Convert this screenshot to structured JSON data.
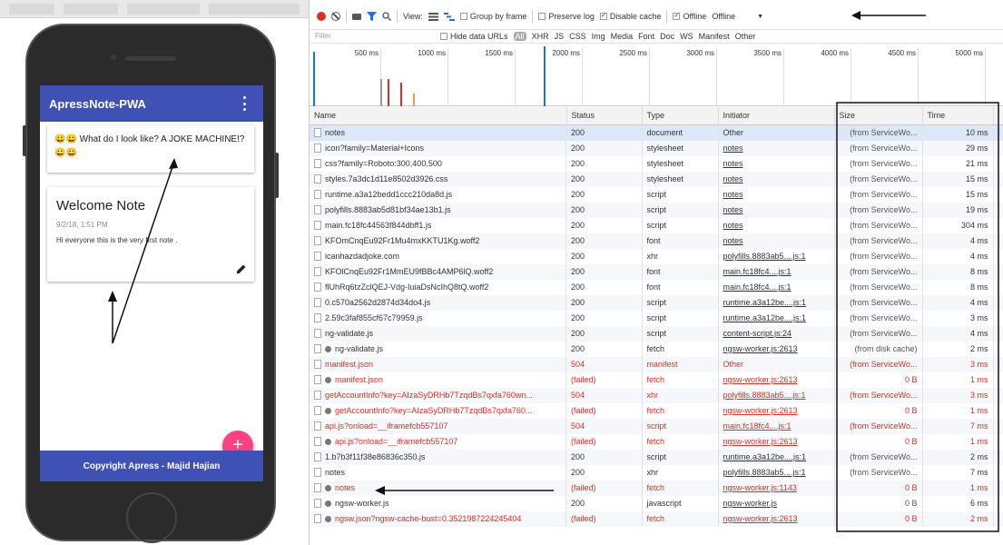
{
  "phone": {
    "app_title": "ApressNote-PWA",
    "joke_text": "😀😀 What do I look like? A JOKE MACHINE!? 😀😀",
    "note_title": "Welcome Note",
    "note_date": "9/2/18, 1:51 PM",
    "note_body": "Hi everyone this is the very first note .",
    "fab_label": "+",
    "footer_text": "Copyright Apress - Majid Hajian"
  },
  "toolbar": {
    "view_label": "View:",
    "group_by_frame": "Group by frame",
    "preserve_log": "Preserve log",
    "disable_cache": "Disable cache",
    "offline_check": "Offline",
    "throttle_select": "Offline",
    "disable_cache_checked": true,
    "offline_checked": true
  },
  "filterbar": {
    "filter_placeholder": "Filter",
    "hide_data_urls": "Hide data URLs",
    "types": [
      "All",
      "XHR",
      "JS",
      "CSS",
      "Img",
      "Media",
      "Font",
      "Doc",
      "WS",
      "Manifest",
      "Other"
    ]
  },
  "timeline": {
    "ticks": [
      "500 ms",
      "1000 ms",
      "1500 ms",
      "2000 ms",
      "2500 ms",
      "3000 ms",
      "3500 ms",
      "4000 ms",
      "4500 ms",
      "5000 ms"
    ]
  },
  "table": {
    "columns": [
      "Name",
      "Status",
      "Type",
      "Initiator",
      "Size",
      "Time"
    ],
    "rows": [
      {
        "name": "notes",
        "status": "200",
        "type": "document",
        "initiator": "Other",
        "size": "(from ServiceWo...",
        "time": "10 ms",
        "gear": false,
        "error": false,
        "selected": true,
        "link": false
      },
      {
        "name": "icon?family=Material+Icons",
        "status": "200",
        "type": "stylesheet",
        "initiator": "notes",
        "size": "(from ServiceWo...",
        "time": "29 ms",
        "gear": false,
        "error": false,
        "link": true
      },
      {
        "name": "css?family=Roboto:300,400,500",
        "status": "200",
        "type": "stylesheet",
        "initiator": "notes",
        "size": "(from ServiceWo...",
        "time": "21 ms",
        "gear": false,
        "error": false,
        "link": true
      },
      {
        "name": "styles.7a3dc1d11e8502d3926.css",
        "status": "200",
        "type": "stylesheet",
        "initiator": "notes",
        "size": "(from ServiceWo...",
        "time": "15 ms",
        "gear": false,
        "error": false,
        "link": true
      },
      {
        "name": "runtime.a3a12bedd1ccc210da8d.js",
        "status": "200",
        "type": "script",
        "initiator": "notes",
        "size": "(from ServiceWo...",
        "time": "15 ms",
        "gear": false,
        "error": false,
        "link": true
      },
      {
        "name": "polyfills.8883ab5d81bf34ae13b1.js",
        "status": "200",
        "type": "script",
        "initiator": "notes",
        "size": "(from ServiceWo...",
        "time": "19 ms",
        "gear": false,
        "error": false,
        "link": true
      },
      {
        "name": "main.fc18fc44563f844dbff1.js",
        "status": "200",
        "type": "script",
        "initiator": "notes",
        "size": "(from ServiceWo...",
        "time": "304 ms",
        "gear": false,
        "error": false,
        "link": true
      },
      {
        "name": "KFOmCnqEu92Fr1Mu4mxKKTU1Kg.woff2",
        "status": "200",
        "type": "font",
        "initiator": "notes",
        "size": "(from ServiceWo...",
        "time": "4 ms",
        "gear": false,
        "error": false,
        "link": true
      },
      {
        "name": "icanhazdadjoke.com",
        "status": "200",
        "type": "xhr",
        "initiator": "polyfills.8883ab5....js:1",
        "size": "(from ServiceWo...",
        "time": "4 ms",
        "gear": false,
        "error": false,
        "link": true
      },
      {
        "name": "KFOlCnqEu92Fr1MmEU9fBBc4AMP6lQ.woff2",
        "status": "200",
        "type": "font",
        "initiator": "main.fc18fc4....js:1",
        "size": "(from ServiceWo...",
        "time": "8 ms",
        "gear": false,
        "error": false,
        "link": true
      },
      {
        "name": "flUhRq6tzZclQEJ-Vdg-IuiaDsNcIhQ8tQ.woff2",
        "status": "200",
        "type": "font",
        "initiator": "main.fc18fc4....js:1",
        "size": "(from ServiceWo...",
        "time": "8 ms",
        "gear": false,
        "error": false,
        "link": true
      },
      {
        "name": "0.c570a2562d2874d34do4.js",
        "status": "200",
        "type": "script",
        "initiator": "runtime.a3a12be....js:1",
        "size": "(from ServiceWo...",
        "time": "4 ms",
        "gear": false,
        "error": false,
        "link": true
      },
      {
        "name": "2.59c3faf855cf67c79959.js",
        "status": "200",
        "type": "script",
        "initiator": "runtime.a3a12be....js:1",
        "size": "(from ServiceWo...",
        "time": "3 ms",
        "gear": false,
        "error": false,
        "link": true
      },
      {
        "name": "ng-validate.js",
        "status": "200",
        "type": "script",
        "initiator": "content-script.js:24",
        "size": "(from ServiceWo...",
        "time": "4 ms",
        "gear": false,
        "error": false,
        "link": true
      },
      {
        "name": "ng-validate.js",
        "status": "200",
        "type": "fetch",
        "initiator": "ngsw-worker.js:2613",
        "size": "(from disk cache)",
        "time": "2 ms",
        "gear": true,
        "error": false,
        "link": true
      },
      {
        "name": "manifest.json",
        "status": "504",
        "type": "manifest",
        "initiator": "Other",
        "size": "(from ServiceWo...",
        "time": "3 ms",
        "gear": false,
        "error": true,
        "link": false
      },
      {
        "name": "manifest.json",
        "status": "(failed)",
        "type": "fetch",
        "initiator": "ngsw-worker.js:2613",
        "size": "0 B",
        "time": "1 ms",
        "gear": true,
        "error": true,
        "link": true
      },
      {
        "name": "getAccountInfo?key=AIzaSyDRHb7TzqdBs7qxfa760wn...",
        "status": "504",
        "type": "xhr",
        "initiator": "polyfills.8883ab5....js:1",
        "size": "(from ServiceWo...",
        "time": "3 ms",
        "gear": false,
        "error": true,
        "link": true
      },
      {
        "name": "getAccountInfo?key=AIzaSyDRHb7TzqdBs7qxfa760...",
        "status": "(failed)",
        "type": "fetch",
        "initiator": "ngsw-worker.js:2613",
        "size": "0 B",
        "time": "1 ms",
        "gear": true,
        "error": true,
        "link": true
      },
      {
        "name": "api.js?onload=__iframefcb557107",
        "status": "504",
        "type": "script",
        "initiator": "main.fc18fc4....js:1",
        "size": "(from ServiceWo...",
        "time": "7 ms",
        "gear": false,
        "error": true,
        "link": true
      },
      {
        "name": "api.js?onload=__iframefcb557107",
        "status": "(failed)",
        "type": "fetch",
        "initiator": "ngsw-worker.js:2613",
        "size": "0 B",
        "time": "1 ms",
        "gear": true,
        "error": true,
        "link": true
      },
      {
        "name": "1.b7b3f11f38e86836c350.js",
        "status": "200",
        "type": "script",
        "initiator": "runtime.a3a12be....js:1",
        "size": "(from ServiceWo...",
        "time": "2 ms",
        "gear": false,
        "error": false,
        "link": true
      },
      {
        "name": "notes",
        "status": "200",
        "type": "xhr",
        "initiator": "polyfills.8883ab5....js:1",
        "size": "(from ServiceWo...",
        "time": "7 ms",
        "gear": false,
        "error": false,
        "link": true
      },
      {
        "name": "notes",
        "status": "(failed)",
        "type": "fetch",
        "initiator": "ngsw-worker.js:1143",
        "size": "0 B",
        "time": "1 ms",
        "gear": true,
        "error": true,
        "link": true
      },
      {
        "name": "ngsw-worker.js",
        "status": "200",
        "type": "javascript",
        "initiator": "ngsw-worker.js",
        "size": "0 B",
        "time": "6 ms",
        "gear": true,
        "error": false,
        "link": true
      },
      {
        "name": "ngsw.json?ngsw-cache-bust=0.3521987224245404",
        "status": "(failed)",
        "type": "fetch",
        "initiator": "ngsw-worker.js:2613",
        "size": "0 B",
        "time": "2 ms",
        "gear": true,
        "error": true,
        "link": true
      }
    ]
  },
  "colors": {
    "appbar": "#3f51b5",
    "fab": "#ff4081",
    "error": "#d93025",
    "record": "#d93025"
  }
}
